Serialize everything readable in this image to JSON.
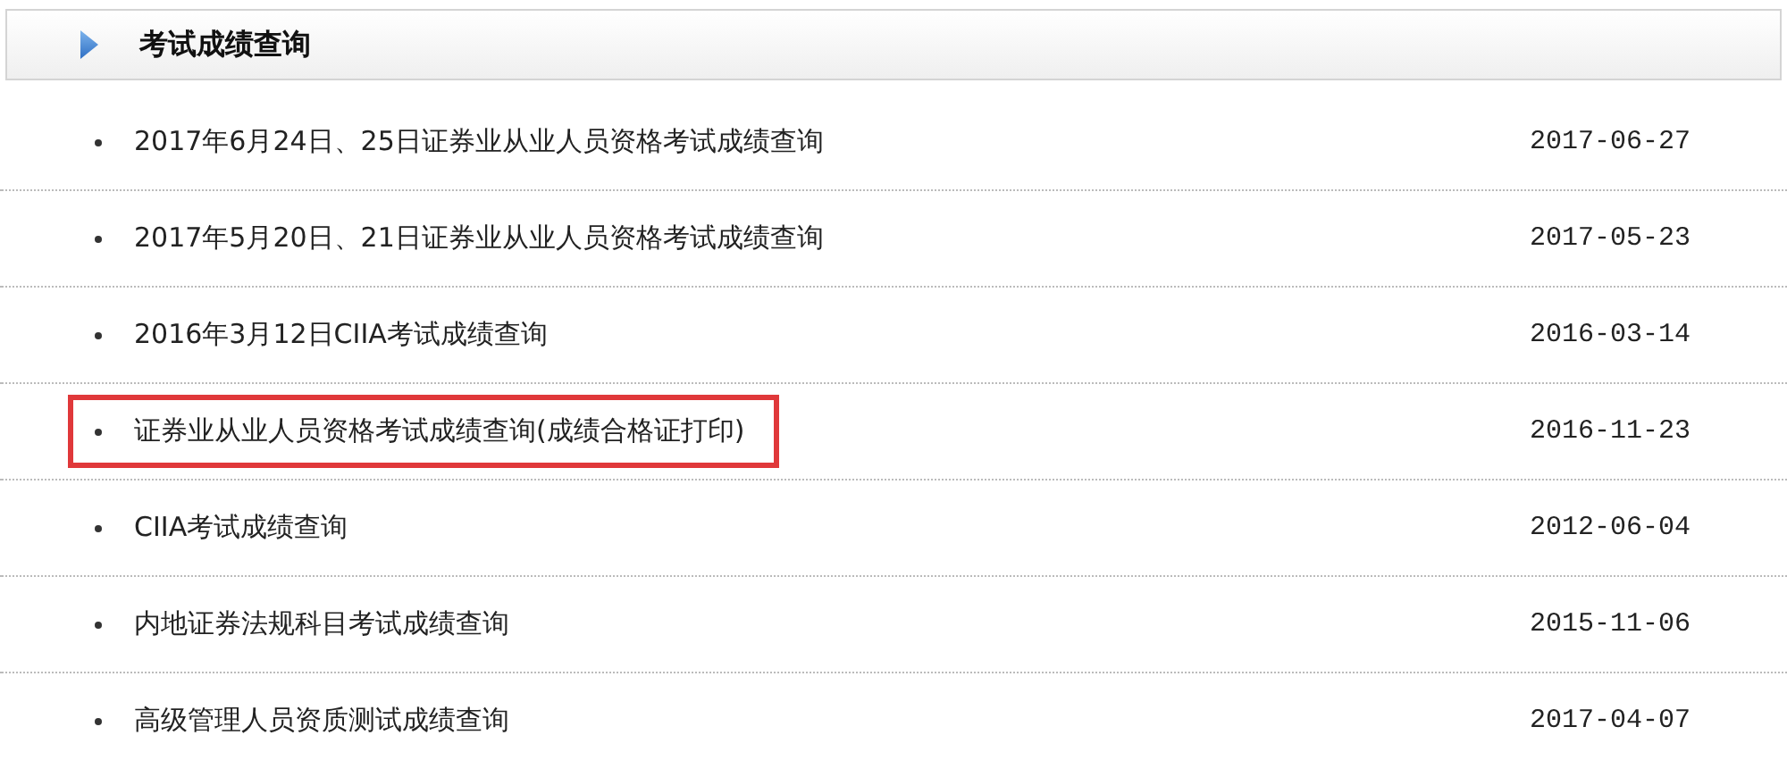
{
  "panel": {
    "title": "考试成绩查询"
  },
  "items": [
    {
      "title": "2017年6月24日、25日证券业从业人员资格考试成绩查询",
      "date": "2017-06-27",
      "highlighted": false
    },
    {
      "title": "2017年5月20日、21日证券业从业人员资格考试成绩查询",
      "date": "2017-05-23",
      "highlighted": false
    },
    {
      "title": "2016年3月12日CIIA考试成绩查询",
      "date": "2016-03-14",
      "highlighted": false
    },
    {
      "title": "证券业从业人员资格考试成绩查询(成绩合格证打印)",
      "date": "2016-11-23",
      "highlighted": true
    },
    {
      "title": "CIIA考试成绩查询",
      "date": "2012-06-04",
      "highlighted": false
    },
    {
      "title": "内地证券法规科目考试成绩查询",
      "date": "2015-11-06",
      "highlighted": false
    },
    {
      "title": "高级管理人员资质测试成绩查询",
      "date": "2017-04-07",
      "highlighted": false
    }
  ]
}
